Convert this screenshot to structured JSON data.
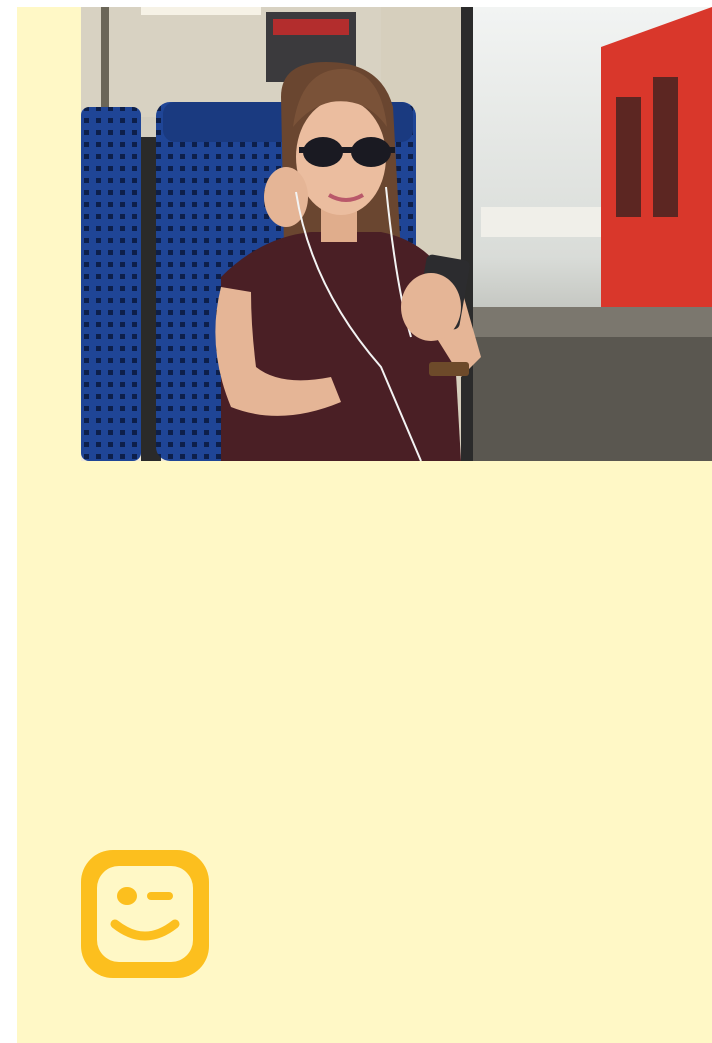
{
  "page": {
    "background_color": "#fff8c6"
  },
  "photo": {
    "icon": "photo-woman-on-train-with-phone",
    "colors": {
      "seat_blue": "#1d3f8f",
      "shirt": "#4a1f25",
      "train_red": "#d9372b",
      "window_light": "#e8ecef"
    }
  },
  "logo": {
    "icon": "winking-face-logo-icon",
    "color": "#fcbf1e"
  }
}
